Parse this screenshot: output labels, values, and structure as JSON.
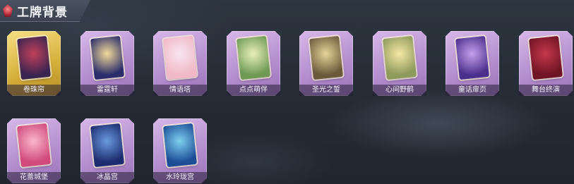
{
  "header": {
    "title": "工牌背景",
    "icon": "rose-icon"
  },
  "cards": [
    {
      "label": "卷珠帘",
      "frame": "gold",
      "art": "#3a2550",
      "art2": "#c0405a",
      "selected": true
    },
    {
      "label": "雷霆轩",
      "frame": "purple",
      "art": "#2a2d6a",
      "art2": "#f2d99a"
    },
    {
      "label": "情语塔",
      "frame": "purple",
      "art": "#f1b8c8",
      "art2": "#f7e6ef"
    },
    {
      "label": "点点萌伴",
      "frame": "purple",
      "art": "#6e9a54",
      "art2": "#e9f0b8"
    },
    {
      "label": "圣光之誓",
      "frame": "purple",
      "art": "#6b5a3a",
      "art2": "#e6d39a"
    },
    {
      "label": "心间野鹤",
      "frame": "purple",
      "art": "#8c9a5c",
      "art2": "#f6e7a4"
    },
    {
      "label": "童话扉页",
      "frame": "purple",
      "art": "#4a2f8c",
      "art2": "#c8a0ee"
    },
    {
      "label": "舞台终演",
      "frame": "purple",
      "art": "#6e1424",
      "art2": "#c4384a"
    },
    {
      "label": "花蕾城堡",
      "frame": "purple",
      "art": "#d04a7a",
      "art2": "#f9b6cc"
    },
    {
      "label": "冰晶宫",
      "frame": "purple",
      "art": "#1d2c6e",
      "art2": "#6a9ae0"
    },
    {
      "label": "水玲珑宫",
      "frame": "purple",
      "art": "#1c4e96",
      "art2": "#7ed0f0"
    }
  ]
}
